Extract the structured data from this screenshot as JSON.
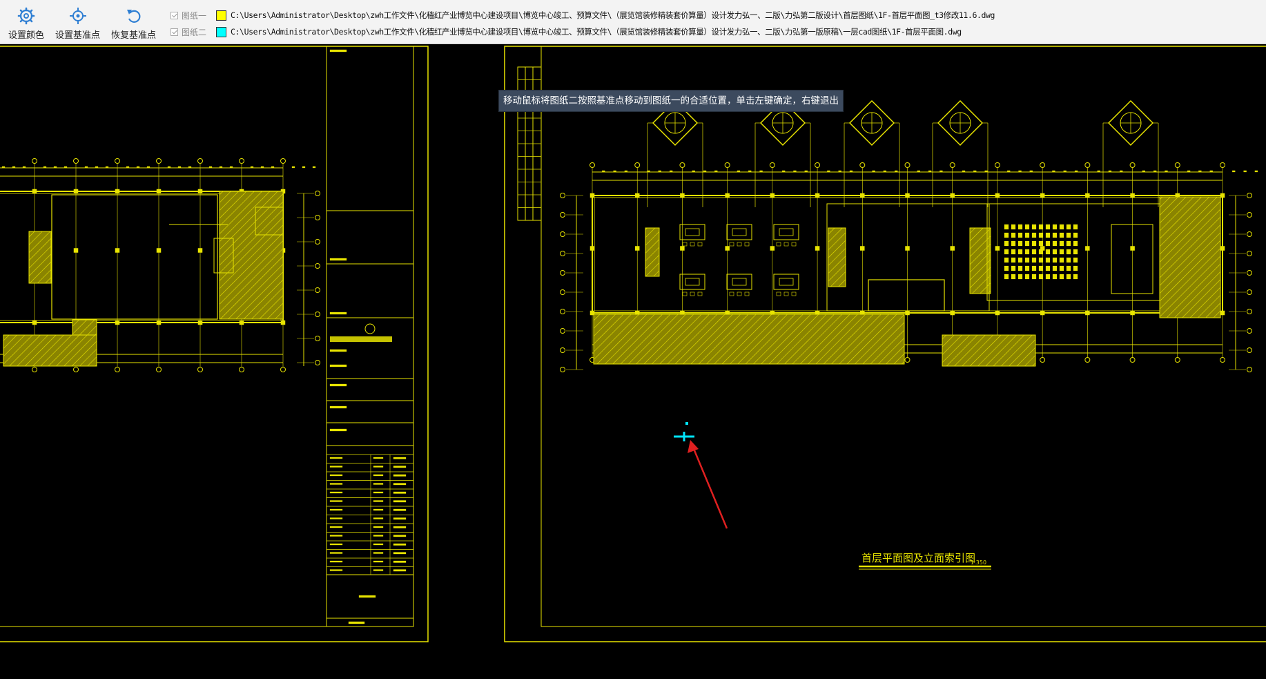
{
  "toolbar": {
    "buttons": [
      {
        "label": "设置颜色",
        "icon": "gear-icon"
      },
      {
        "label": "设置基准点",
        "icon": "crosshair-icon"
      },
      {
        "label": "恢复基准点",
        "icon": "undo-icon"
      }
    ],
    "files": [
      {
        "checked": true,
        "name": "图纸一",
        "color": "#ffff00",
        "path": "C:\\Users\\Administrator\\Desktop\\zwh工作文件\\化穑红产业博览中心建设项目\\博览中心竣工、预算文件\\（展览馆装修精装套价算量）设计发力弘一、二版\\力弘第二版设计\\首层图纸\\1F-首层平面图_t3修改11.6.dwg"
      },
      {
        "checked": true,
        "name": "图纸二",
        "color": "#00ffff",
        "path": "C:\\Users\\Administrator\\Desktop\\zwh工作文件\\化穑红产业博览中心建设项目\\博览中心竣工、预算文件\\（展览馆装修精装套价算量）设计发力弘一、二版\\力弘第一版原稿\\一层cad图纸\\1F-首层平面图.dwg"
      }
    ]
  },
  "tooltip": "移动鼠标将图纸二按照基准点移动到图纸一的合适位置，单击左键确定，右键退出",
  "drawing": {
    "title": "首层平面图及立面索引图",
    "scale": "1:350",
    "colors": {
      "drawing1": "#e8e400",
      "drawing2": "#00ffff",
      "arrow": "#e02020"
    }
  }
}
